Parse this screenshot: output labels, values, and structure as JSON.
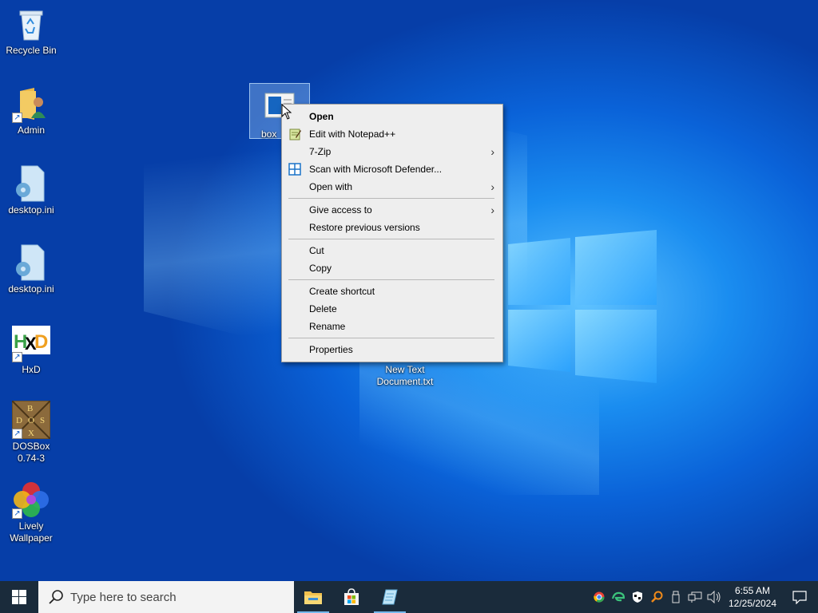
{
  "desktop": {
    "icons": [
      {
        "label": "Recycle Bin"
      },
      {
        "label": "Admin"
      },
      {
        "label": "desktop.ini"
      },
      {
        "label": "desktop.ini"
      },
      {
        "label": "HxD"
      },
      {
        "label": "DOSBox 0.74-3"
      },
      {
        "label": "Lively Wallpaper"
      },
      {
        "label": "box"
      },
      {
        "label": "New Text Document.txt"
      }
    ]
  },
  "context_menu": {
    "open": "Open",
    "edit_notepad": "Edit with Notepad++",
    "seven_zip": "7-Zip",
    "scan_defender": "Scan with Microsoft Defender...",
    "open_with": "Open with",
    "give_access": "Give access to",
    "restore_versions": "Restore previous versions",
    "cut": "Cut",
    "copy": "Copy",
    "create_shortcut": "Create shortcut",
    "delete": "Delete",
    "rename": "Rename",
    "properties": "Properties",
    "submenu_arrow": "›"
  },
  "taskbar": {
    "search_placeholder": "Type here to search",
    "apps": [
      "file-explorer-icon",
      "microsoft-store-icon",
      "notepad-icon"
    ],
    "clock_time": "6:55 AM",
    "clock_date": "12/25/2024"
  },
  "colors": {
    "taskbar_bg": "#1a2b3b",
    "menu_bg": "#eeeeee",
    "accent": "#0078d7"
  }
}
